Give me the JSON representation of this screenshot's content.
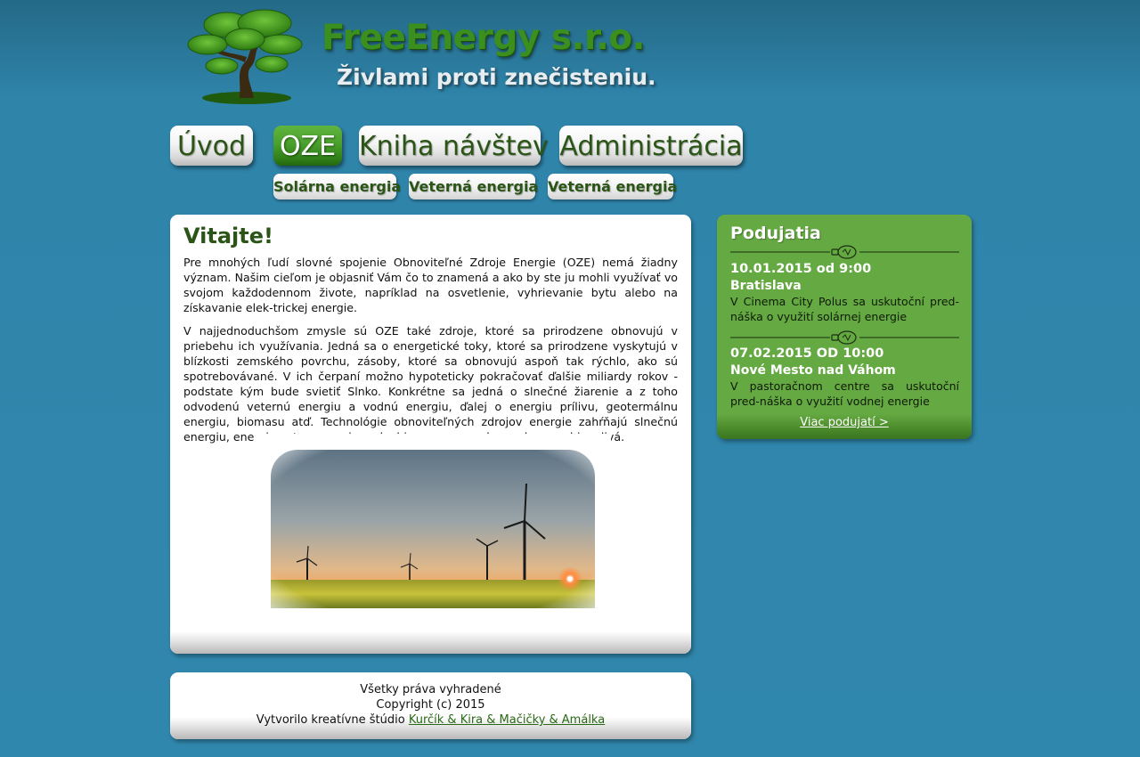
{
  "header": {
    "title": "FreeEnergy s.r.o.",
    "slogan": "Živlami proti znečisteniu."
  },
  "nav": {
    "items": [
      {
        "label": "Úvod",
        "active": false
      },
      {
        "label": "OZE",
        "active": true
      },
      {
        "label": "Kniha návštev",
        "active": false
      },
      {
        "label": "Administrácia",
        "active": false
      }
    ],
    "subitems": [
      {
        "label": "Solárna energia"
      },
      {
        "label": "Veterná energia"
      },
      {
        "label": "Veterná energia"
      }
    ]
  },
  "main": {
    "heading": "Vitajte!",
    "paragraphs": [
      "Pre mnohých ľudí slovné spojenie Obnoviteľné Zdroje Energie (OZE) nemá žiadny význam. Našim cieľom je objasniť Vám čo to znamená a ako by ste ju mohli využívať vo svojom každodennom živote, napríklad na osvetlenie, vyhrievanie bytu alebo na získavanie elek-trickej energie.",
      "V najjednoduchšom zmysle sú OZE také zdroje, ktoré sa prirodzene obnovujú v priebehu ich využívania. Jedná sa o energetické toky, ktoré sa prirodzene vyskytujú v blízkosti zemského povrchu, zásoby, ktoré sa obnovujú aspoň tak rýchlo, ako sú spotrebovávané. V ich čerpaní možno hypoteticky pokračovať ďalšie miliardy rokov - podstate kým bude svietiť Slnko. Konkrétne sa jedná o slnečné žiarenie a z toho odvodenú veternú energiu a vodnú energiu, ďalej o energiu prílivu, geotermálnu energiu, biomasu atď. Technológie obnoviteľných zdrojov energie zahŕňajú slnečnú energiu, energiu vetra, energiu vody, biomasu a napokon v doprave biopalivá."
    ]
  },
  "events": {
    "heading": "Podujatia",
    "items": [
      {
        "date": "10.01.2015 od 9:00",
        "place": "Bratislava",
        "description": "V Cinema City Polus sa uskutoční pred-náška o využití solárnej energie"
      },
      {
        "date": "07.02.2015 OD 10:00",
        "place": "Nové Mesto nad Váhom",
        "description": "V pastoračnom centre sa uskutoční pred-náška o využití vodnej energie"
      }
    ],
    "more_link": "Viac podujatí >"
  },
  "footer": {
    "rights": "Všetky práva vyhradené",
    "copyright": "Copyright (c) 2015",
    "credit_prefix": "Vytvorilo kreatívne štúdio ",
    "credit_link": "Kurčík & Kira & Mačičky & Amálka"
  },
  "colors": {
    "page_background": "#3087ad",
    "brand_green": "#3a8f1e",
    "text_green": "#2a5516",
    "active_nav_green": "#4aa02c",
    "events_panel_green": "#65a942"
  },
  "icons": {
    "logo": "tree-logo-icon",
    "divider": "lightbulb-icon"
  }
}
